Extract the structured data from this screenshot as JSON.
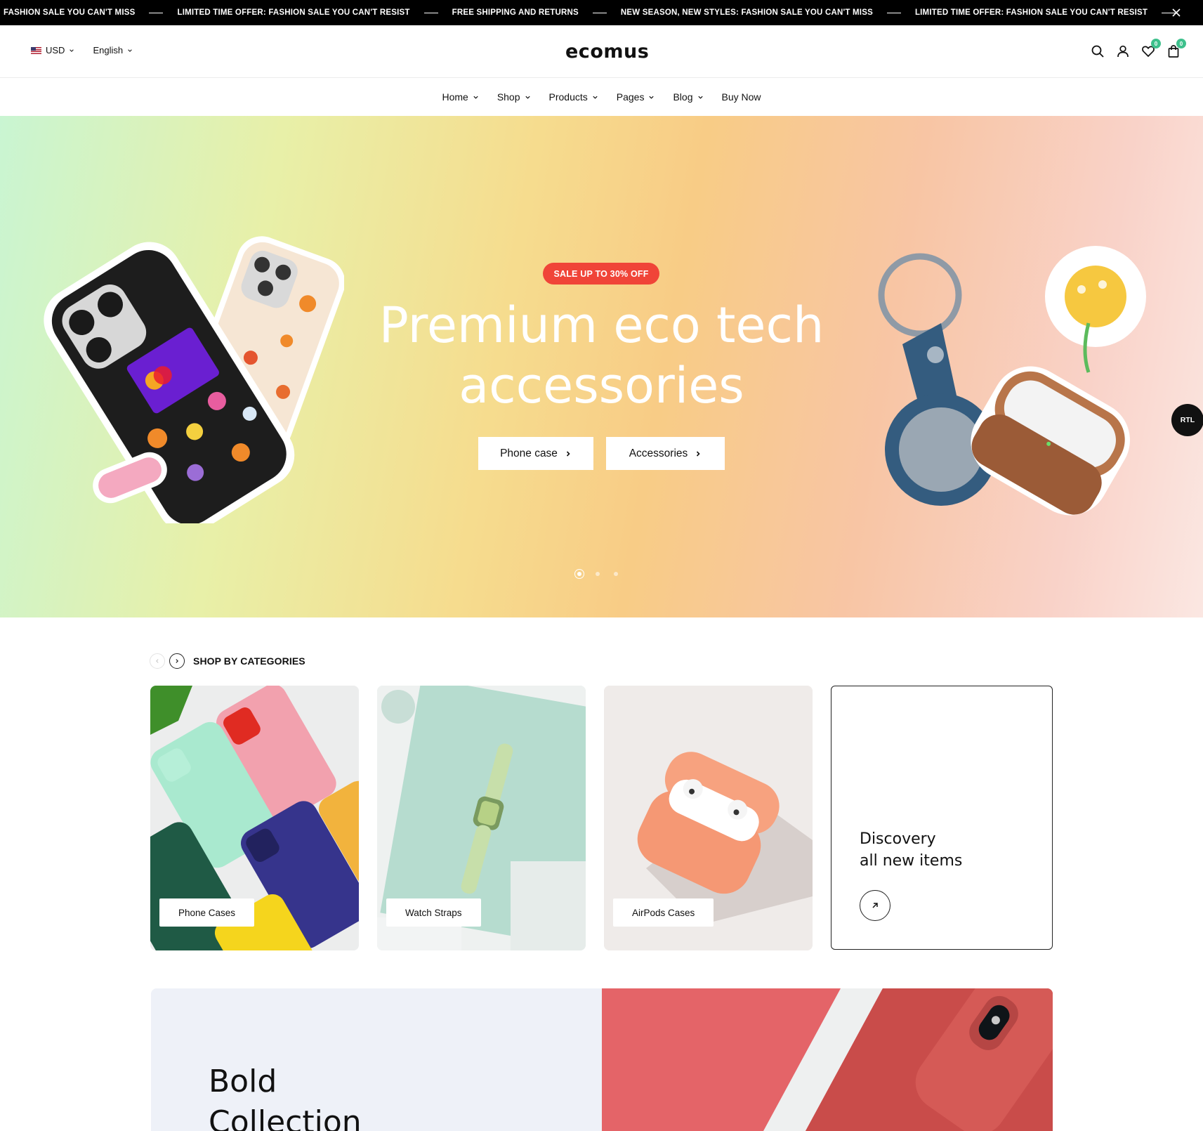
{
  "announcement": {
    "items": [
      "FASHION SALE YOU CAN'T MISS",
      "LIMITED TIME OFFER: FASHION SALE YOU CAN'T RESIST",
      "FREE SHIPPING AND RETURNS",
      "NEW SEASON, NEW STYLES: FASHION SALE YOU CAN'T MISS",
      "LIMITED TIME OFFER: FASHION SALE YOU CAN'T RESIST"
    ]
  },
  "header": {
    "currency": "USD",
    "language": "English",
    "logo": "ecomus",
    "wishlist_count": "0",
    "cart_count": "0"
  },
  "nav": {
    "items": [
      {
        "label": "Home"
      },
      {
        "label": "Shop"
      },
      {
        "label": "Products"
      },
      {
        "label": "Pages"
      },
      {
        "label": "Blog"
      },
      {
        "label": "Buy Now"
      }
    ]
  },
  "hero": {
    "badge": "SALE UP TO 30% OFF",
    "title_line1": "Premium eco tech",
    "title_line2": "accessories",
    "buttons": [
      {
        "label": "Phone case"
      },
      {
        "label": "Accessories"
      }
    ],
    "slide_count": 3,
    "active_slide": 1,
    "rtl_toggle": "RTL"
  },
  "categories": {
    "title": "SHOP BY CATEGORIES",
    "items": [
      {
        "label": "Phone Cases"
      },
      {
        "label": "Watch Straps"
      },
      {
        "label": "AirPods Cases"
      }
    ],
    "discover_line1": "Discovery",
    "discover_line2": "all new items"
  },
  "collection": {
    "title_line1": "Bold",
    "title_line2": "Collection"
  },
  "colors": {
    "badge_red": "#f04438",
    "counter_green": "#3ec08c",
    "announcement_bg": "#000000"
  }
}
